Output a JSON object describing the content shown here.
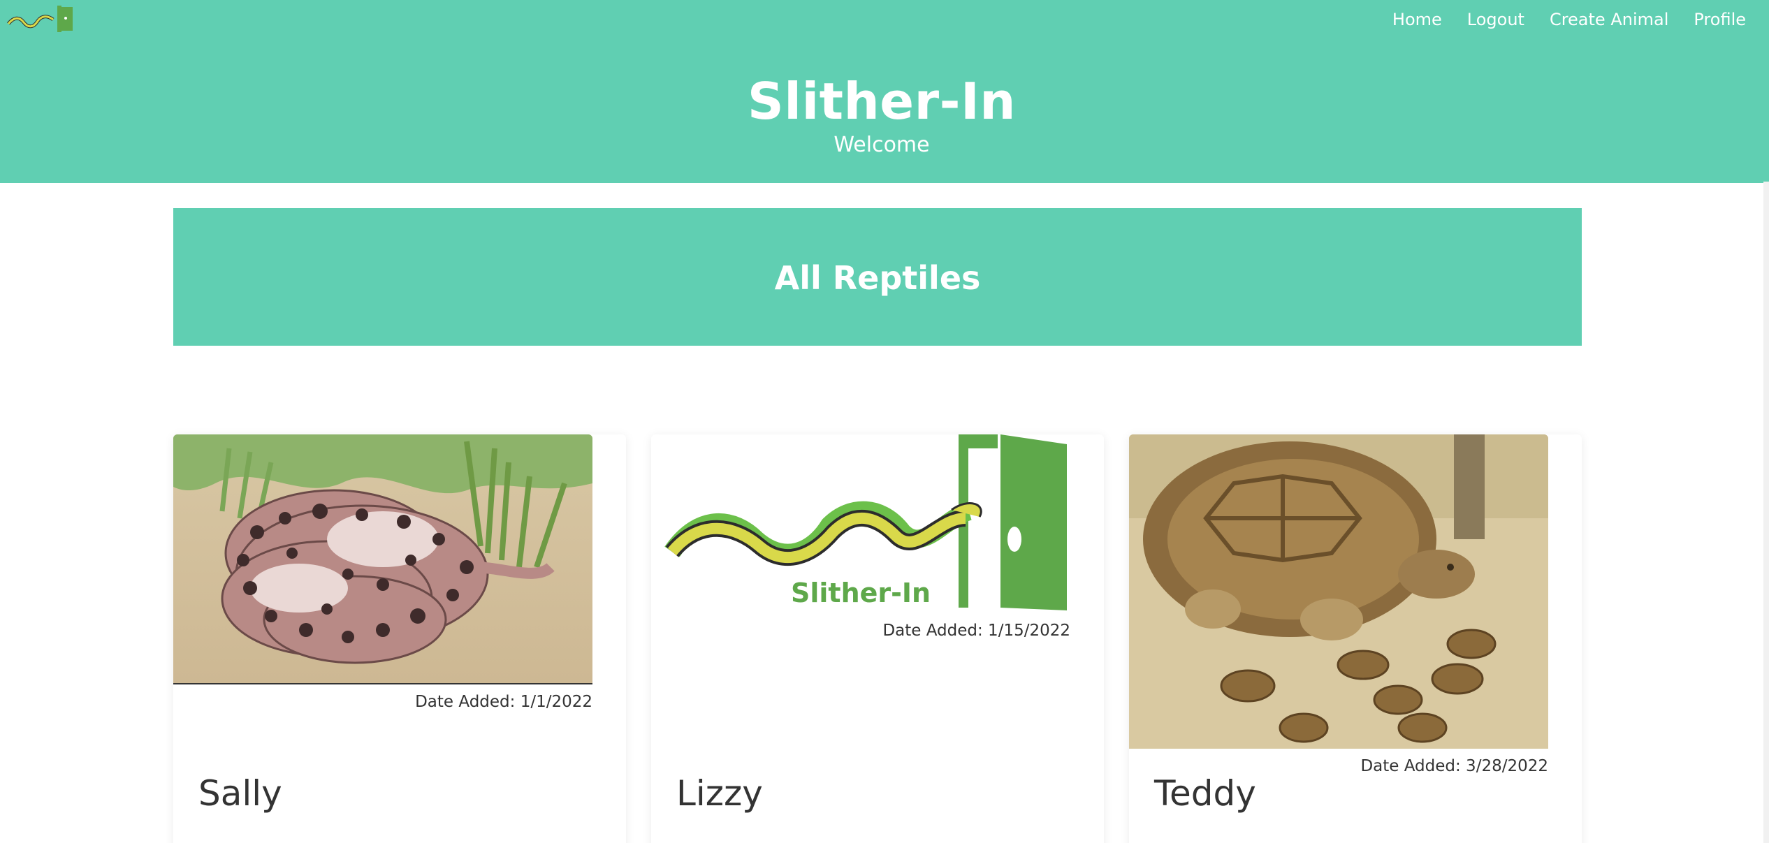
{
  "nav": {
    "items": [
      "Home",
      "Logout",
      "Create Animal",
      "Profile"
    ]
  },
  "header": {
    "title": "Slither-In",
    "subtitle": "Welcome"
  },
  "section": {
    "title": "All Reptiles"
  },
  "logo": {
    "text": "Slither-In",
    "colors": {
      "green": "#5ea84a",
      "snake_yellow": "#d9d94a",
      "snake_green": "#6cc04a"
    }
  },
  "cards": [
    {
      "name": "Sally",
      "date_added": "Date Added: 1/1/2022",
      "image": "snake-photo"
    },
    {
      "name": "Lizzy",
      "date_added": "Date Added: 1/15/2022",
      "image": "slither-in-logo"
    },
    {
      "name": "Teddy",
      "date_added": "Date Added: 3/28/2022",
      "image": "tortoise-photo"
    }
  ],
  "theme": {
    "accent": "#60cfb2",
    "text": "#333333"
  }
}
